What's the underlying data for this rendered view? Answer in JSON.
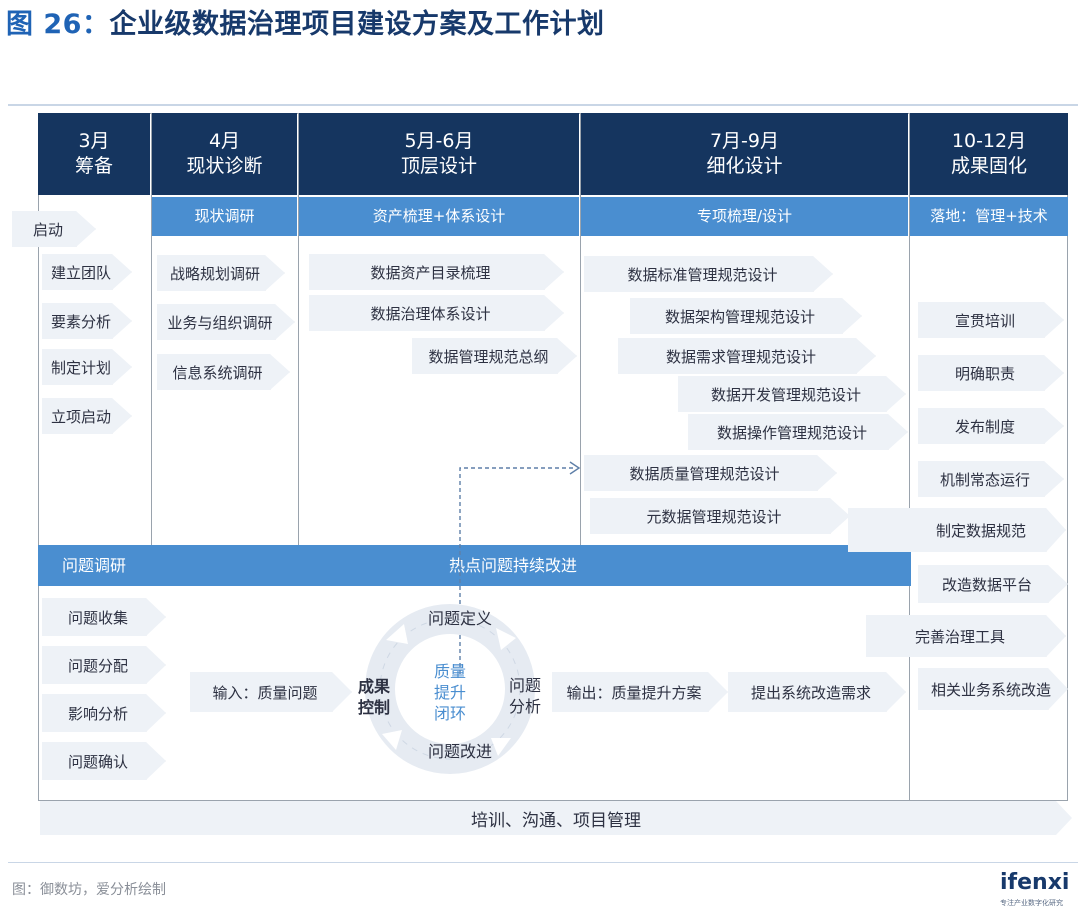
{
  "title": {
    "fig": "图 26：",
    "text": "企业级数据治理项目建设方案及工作计划"
  },
  "phases": [
    {
      "month": "3月",
      "name": "筹备"
    },
    {
      "month": "4月",
      "name": "现状诊断"
    },
    {
      "month": "5月-6月",
      "name": "顶层设计"
    },
    {
      "month": "7月-9月",
      "name": "细化设计"
    },
    {
      "month": "10-12月",
      "name": "成果固化"
    }
  ],
  "subheaders": [
    "现状调研",
    "资产梳理+体系设计",
    "专项梳理/设计",
    "落地：管理+技术"
  ],
  "prep": {
    "start": "启动",
    "items": [
      "建立团队",
      "要素分析",
      "制定计划",
      "立项启动"
    ]
  },
  "diagnosis": [
    "战略规划调研",
    "业务与组织调研",
    "信息系统调研"
  ],
  "top_design": [
    "数据资产目录梳理",
    "数据治理体系设计",
    "数据管理规范总纲"
  ],
  "detail_design": [
    "数据标准管理规范设计",
    "数据架构管理规范设计",
    "数据需求管理规范设计",
    "数据开发管理规范设计",
    "数据操作管理规范设计",
    "数据质量管理规范设计",
    "元数据管理规范设计"
  ],
  "solidify": [
    "宣贯培训",
    "明确职责",
    "发布制度",
    "机制常态运行",
    "制定数据规范",
    "改造数据平台",
    "完善治理工具",
    "相关业务系统改造"
  ],
  "hotspot": {
    "left": "问题调研",
    "center": "热点问题持续改进"
  },
  "issue_steps": [
    "问题收集",
    "问题分配",
    "影响分析",
    "问题确认"
  ],
  "cycle": {
    "input": "输入：质量问题",
    "output": "输出：质量提升方案",
    "next": "提出系统改造需求",
    "center": [
      "质量",
      "提升",
      "闭环"
    ],
    "define": "问题定义",
    "analyze": [
      "问题",
      "分析"
    ],
    "improve": "问题改进",
    "control": [
      "成果",
      "控制"
    ]
  },
  "bottom": "培训、沟通、项目管理",
  "source": "图：御数坊，爱分析绘制",
  "logo": {
    "name": "ifenxi",
    "tagline": "专注产业数字化研究"
  },
  "colors": {
    "header_dark": "#15355f",
    "header_blue": "#4a8ed0",
    "arrow_fill": "#eef2f7",
    "title": "#17396b"
  }
}
